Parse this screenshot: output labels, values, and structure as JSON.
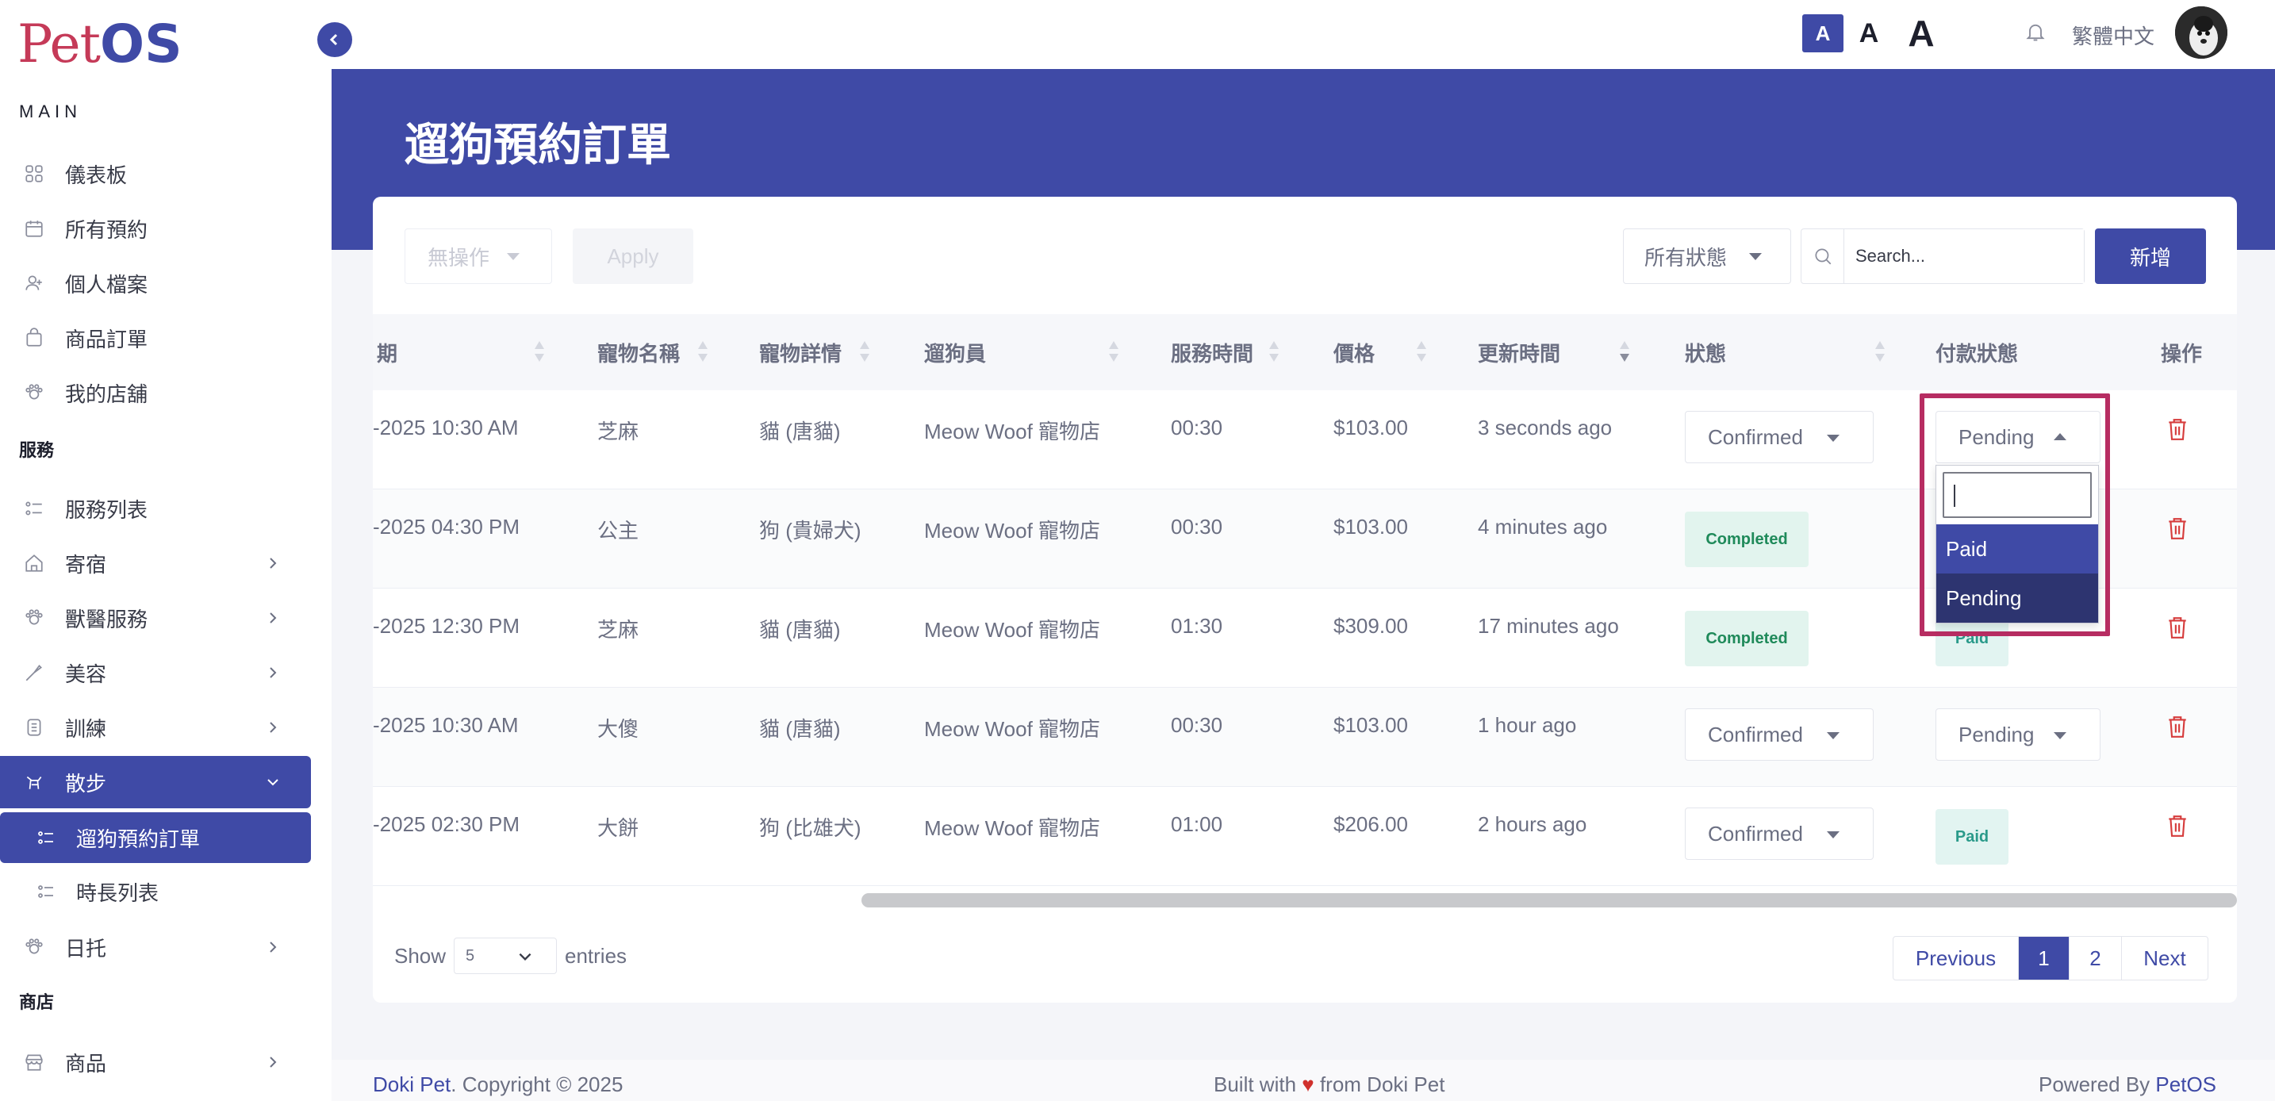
{
  "app": {
    "logo_pet": "Pet",
    "logo_os": "OS"
  },
  "sidebar": {
    "section_main": "MAIN",
    "section_services": "服務",
    "section_shop": "商店",
    "items": [
      {
        "label": "儀表板",
        "icon": "dashboard-icon"
      },
      {
        "label": "所有預約",
        "icon": "calendar-icon"
      },
      {
        "label": "個人檔案",
        "icon": "user-icon"
      },
      {
        "label": "商品訂單",
        "icon": "bag-icon"
      },
      {
        "label": "我的店舖",
        "icon": "store-icon"
      },
      {
        "label": "服務列表",
        "icon": "list-icon"
      },
      {
        "label": "寄宿",
        "icon": "home-icon"
      },
      {
        "label": "獸醫服務",
        "icon": "vet-icon"
      },
      {
        "label": "美容",
        "icon": "grooming-icon"
      },
      {
        "label": "訓練",
        "icon": "training-icon"
      },
      {
        "label": "散步",
        "icon": "walk-icon"
      },
      {
        "label": "遛狗預約訂單",
        "icon": "list-icon"
      },
      {
        "label": "時長列表",
        "icon": "list-icon"
      },
      {
        "label": "日托",
        "icon": "daycare-icon"
      },
      {
        "label": "商品",
        "icon": "shop-icon"
      }
    ]
  },
  "topbar": {
    "font_sizes": [
      "A",
      "A",
      "A"
    ],
    "language": "繁體中文"
  },
  "page": {
    "title": "遛狗預約訂單"
  },
  "toolbar": {
    "bulk_action": "無操作",
    "apply": "Apply",
    "status_filter": "所有狀態",
    "search_placeholder": "Search...",
    "add_button": "新增"
  },
  "table": {
    "headers": [
      "期",
      "寵物名稱",
      "寵物詳情",
      "遛狗員",
      "服務時間",
      "價格",
      "更新時間",
      "狀態",
      "付款狀態",
      "操作"
    ],
    "rows": [
      {
        "date": "-2025 10:30 AM",
        "pet": "芝麻",
        "detail": "貓 (唐貓)",
        "walker": "Meow Woof 寵物店",
        "duration": "00:30",
        "price": "$103.00",
        "updated": "3 seconds ago",
        "status": "Confirmed",
        "payment": "Pending"
      },
      {
        "date": "-2025 04:30 PM",
        "pet": "公主",
        "detail": "狗 (貴婦犬)",
        "walker": "Meow Woof 寵物店",
        "duration": "00:30",
        "price": "$103.00",
        "updated": "4 minutes ago",
        "status": "Completed",
        "payment": ""
      },
      {
        "date": "-2025 12:30 PM",
        "pet": "芝麻",
        "detail": "貓 (唐貓)",
        "walker": "Meow Woof 寵物店",
        "duration": "01:30",
        "price": "$309.00",
        "updated": "17 minutes ago",
        "status": "Completed",
        "payment": "Paid"
      },
      {
        "date": "-2025 10:30 AM",
        "pet": "大傻",
        "detail": "貓 (唐貓)",
        "walker": "Meow Woof 寵物店",
        "duration": "00:30",
        "price": "$103.00",
        "updated": "1 hour ago",
        "status": "Confirmed",
        "payment": "Pending"
      },
      {
        "date": "-2025 02:30 PM",
        "pet": "大餅",
        "detail": "狗 (比雄犬)",
        "walker": "Meow Woof 寵物店",
        "duration": "01:00",
        "price": "$206.00",
        "updated": "2 hours ago",
        "status": "Confirmed",
        "payment": "Paid"
      }
    ]
  },
  "dropdown": {
    "options": [
      "Paid",
      "Pending"
    ]
  },
  "pagination": {
    "show_label": "Show",
    "entries_value": "5",
    "entries_label": "entries",
    "previous": "Previous",
    "pages": [
      "1",
      "2"
    ],
    "next": "Next"
  },
  "footer": {
    "brand": "Doki Pet",
    "copyright": ". Copyright © 2025",
    "built_prefix": "Built with",
    "heart": "♥",
    "built_suffix": "from Doki Pet",
    "powered_prefix": "Powered By",
    "powered_brand": "PetOS"
  },
  "colors": {
    "primary": "#3f4aa6",
    "logo_red": "#c53a58",
    "highlight": "#b72d62",
    "danger": "#d63c3c"
  }
}
